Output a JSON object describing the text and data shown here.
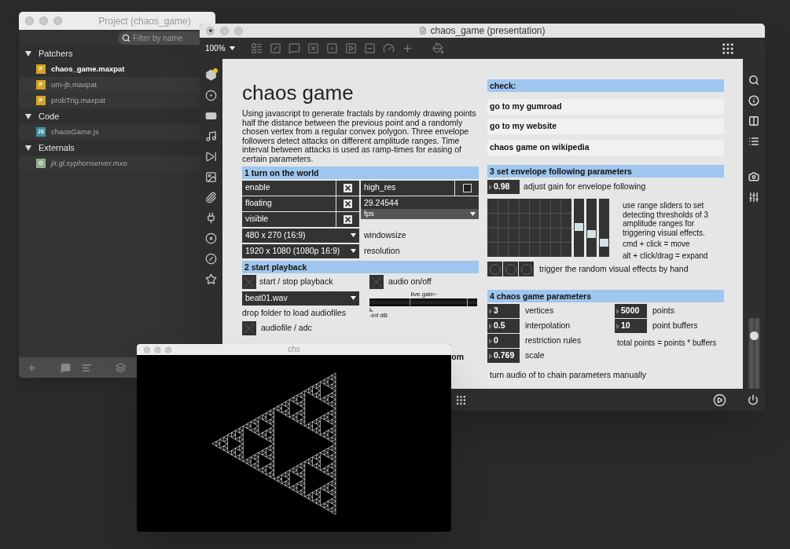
{
  "project_window": {
    "title": "Project (chaos_game)",
    "filter": {
      "placeholder": "Filter by name"
    },
    "groups": [
      {
        "label": "Patchers",
        "expanded": true,
        "children": [
          {
            "name": "chaos_game.maxpat",
            "badge": "P",
            "color": "#d6a520",
            "selected": true
          },
          {
            "name": "urn-jb.maxpat",
            "badge": "P",
            "color": "#d6a520",
            "selected": false
          },
          {
            "name": "probTrig.maxpat",
            "badge": "P",
            "color": "#d6a520",
            "selected": false
          }
        ]
      },
      {
        "label": "Code",
        "expanded": true,
        "children": [
          {
            "name": "chaosGame.js",
            "badge": "JS",
            "color": "#3f8fa8",
            "selected": false
          }
        ]
      },
      {
        "label": "Externals",
        "expanded": true,
        "children": [
          {
            "name": "jit.gl.syphonserver.mxo",
            "badge": "O",
            "color": "#8fb28a",
            "selected": false
          }
        ]
      }
    ]
  },
  "main_window": {
    "title": "chaos_game (presentation)",
    "zoom": "100%",
    "master_gain": {
      "level": 0.75
    },
    "patch": {
      "title": "chaos game",
      "description": "Using javascript to generate fractals by randomly drawing points half the distance between the previous point and a randomly chosen vertex from a regular convex polygon. Three envelope followers detect attacks on different amplitude ranges. Time interval between attacks is used as ramp-times for easing of certain parameters.",
      "world": {
        "heading": "1 turn on the world",
        "toggles": [
          {
            "label": "enable",
            "checked": true
          },
          {
            "label": "floating",
            "checked": true
          },
          {
            "label": "visible",
            "checked": true
          }
        ],
        "high_res": {
          "label": "high_res",
          "checked": false
        },
        "fps_value": "29.24544",
        "fps_menu": "fps",
        "menus": [
          {
            "value": "480 x 270 (16:9)",
            "label": "windowsize"
          },
          {
            "value": "1920 x 1080 (1080p 16:9)",
            "label": "resolution"
          }
        ]
      },
      "playback": {
        "heading": "2 start playback",
        "start": {
          "label": "start / stop playback",
          "on": false
        },
        "audio": {
          "label": "audio on/off",
          "on": false
        },
        "file_menu": "beat01.wav",
        "drop_hint": "drop folder to load audiofiles",
        "adc": {
          "label": "audiofile / adc",
          "on": false
        },
        "gain": {
          "title": "live.gain~",
          "level": 0.37,
          "reading": "-inf dB"
        },
        "partial_label": "om"
      },
      "links": {
        "heading": "check:",
        "items": [
          "go to my gumroad",
          "go to my website",
          "chaos game on wikipedia"
        ]
      },
      "envelope": {
        "heading": "3 set envelope following parameters",
        "gain": {
          "value": "0.98",
          "label": "adjust gain for envelope following"
        },
        "sliders": [
          {
            "level": 0.51
          },
          {
            "level": 0.39
          },
          {
            "level": 0.24
          }
        ],
        "help": [
          "use range sliders to set detecting thresholds of 3 amplitude ranges for triggering visual effects.",
          "cmd + click = move",
          "alt + click/drag = expand"
        ],
        "triggers_label": "trigger the random visual effects by hand"
      },
      "params": {
        "heading": "4 chaos game parameters",
        "left": [
          {
            "value": "3",
            "label": "vertices"
          },
          {
            "value": "0.5",
            "label": "interpolation"
          },
          {
            "value": "0",
            "label": "restriction rules"
          },
          {
            "value": "0.769",
            "label": "scale"
          }
        ],
        "right": [
          {
            "value": "5000",
            "label": "points"
          },
          {
            "value": "10",
            "label": "point buffers"
          }
        ],
        "total_note": "total points = points * buffers",
        "footer": "turn audio of to chain parameters manually"
      }
    }
  },
  "render_window": {
    "title": "chs"
  }
}
